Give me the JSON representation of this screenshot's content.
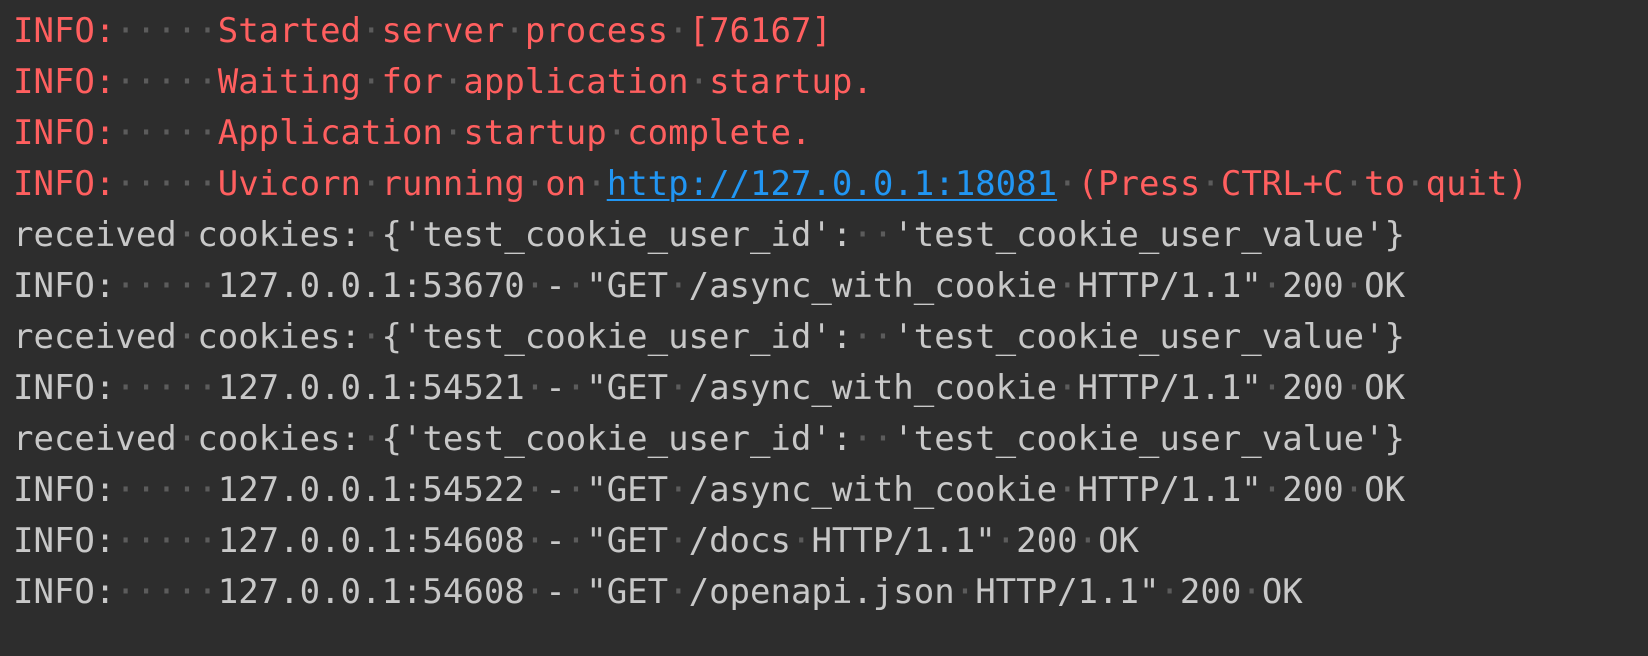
{
  "terminal": {
    "title": "uvicorn server log",
    "colors": {
      "background": "#2d2d2d",
      "info_red": "#ff5f5f",
      "text_gray": "#c8c8c8",
      "link_blue": "#2196f3",
      "whitespace_dot": "#5c5c5c"
    },
    "whitespace_char": "·",
    "lines": [
      {
        "id": "line-1",
        "segments": [
          {
            "text": "INFO:",
            "color": "red"
          },
          {
            "text": "     ",
            "color": "ws"
          },
          {
            "text": "Started server process [76167]",
            "color": "red"
          }
        ]
      },
      {
        "id": "line-2",
        "segments": [
          {
            "text": "INFO:",
            "color": "red"
          },
          {
            "text": "     ",
            "color": "ws"
          },
          {
            "text": "Waiting for application startup.",
            "color": "red"
          }
        ]
      },
      {
        "id": "line-3",
        "segments": [
          {
            "text": "INFO:",
            "color": "red"
          },
          {
            "text": "     ",
            "color": "ws"
          },
          {
            "text": "Application startup complete.",
            "color": "red"
          }
        ]
      },
      {
        "id": "line-4",
        "segments": [
          {
            "text": "INFO:",
            "color": "red"
          },
          {
            "text": "     ",
            "color": "ws"
          },
          {
            "text": "Uvicorn running on ",
            "color": "red"
          },
          {
            "text": "http://127.0.0.1:18081",
            "color": "blue"
          },
          {
            "text": " ",
            "color": "ws"
          },
          {
            "text": "(Press CTRL+C to quit)",
            "color": "red"
          }
        ]
      },
      {
        "id": "line-5",
        "segments": [
          {
            "text": "received cookies: {'test_cookie_user_id':  'test_cookie_user_value'}",
            "color": "gray"
          }
        ]
      },
      {
        "id": "line-6",
        "segments": [
          {
            "text": "INFO:",
            "color": "gray"
          },
          {
            "text": "     ",
            "color": "ws"
          },
          {
            "text": "127.0.0.1:53670 - \"GET /async_with_cookie HTTP/1.1\" 200 OK",
            "color": "gray"
          }
        ]
      },
      {
        "id": "line-7",
        "segments": [
          {
            "text": "received cookies: {'test_cookie_user_id':  'test_cookie_user_value'}",
            "color": "gray"
          }
        ]
      },
      {
        "id": "line-8",
        "segments": [
          {
            "text": "INFO:",
            "color": "gray"
          },
          {
            "text": "     ",
            "color": "ws"
          },
          {
            "text": "127.0.0.1:54521 - \"GET /async_with_cookie HTTP/1.1\" 200 OK",
            "color": "gray"
          }
        ]
      },
      {
        "id": "line-9",
        "segments": [
          {
            "text": "received cookies: {'test_cookie_user_id':  'test_cookie_user_value'}",
            "color": "gray"
          }
        ]
      },
      {
        "id": "line-10",
        "segments": [
          {
            "text": "INFO:",
            "color": "gray"
          },
          {
            "text": "     ",
            "color": "ws"
          },
          {
            "text": "127.0.0.1:54522 - \"GET /async_with_cookie HTTP/1.1\" 200 OK",
            "color": "gray"
          }
        ]
      },
      {
        "id": "line-11",
        "segments": [
          {
            "text": "INFO:",
            "color": "gray"
          },
          {
            "text": "     ",
            "color": "ws"
          },
          {
            "text": "127.0.0.1:54608 - \"GET /docs HTTP/1.1\" 200 OK",
            "color": "gray"
          }
        ]
      },
      {
        "id": "line-12",
        "segments": [
          {
            "text": "INFO:",
            "color": "gray"
          },
          {
            "text": "     ",
            "color": "ws"
          },
          {
            "text": "127.0.0.1:54608 - \"GET /openapi.json HTTP/1.1\" 200 OK",
            "color": "gray"
          }
        ]
      }
    ]
  }
}
